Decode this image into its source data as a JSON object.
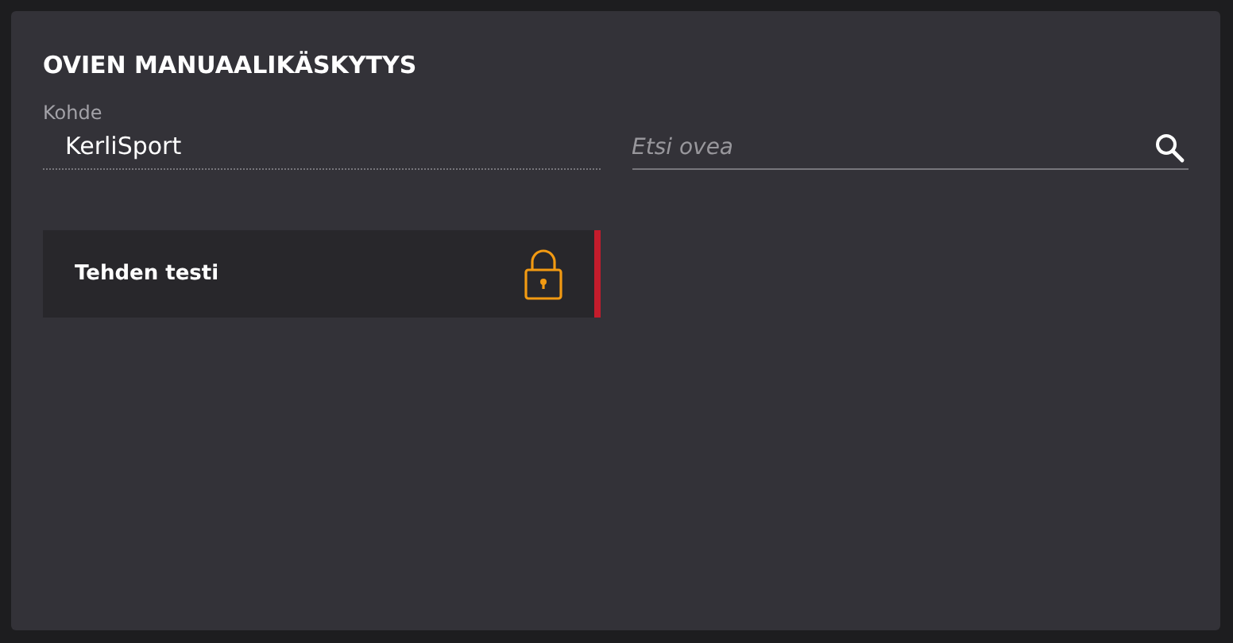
{
  "title": "OVIEN MANUAALIKÄSKYTYS",
  "target": {
    "label": "Kohde",
    "value": "KerliSport"
  },
  "search": {
    "placeholder": "Etsi ovea"
  },
  "doors": [
    {
      "name": "Tehden testi",
      "locked": true,
      "color": "#c41c2c"
    }
  ]
}
